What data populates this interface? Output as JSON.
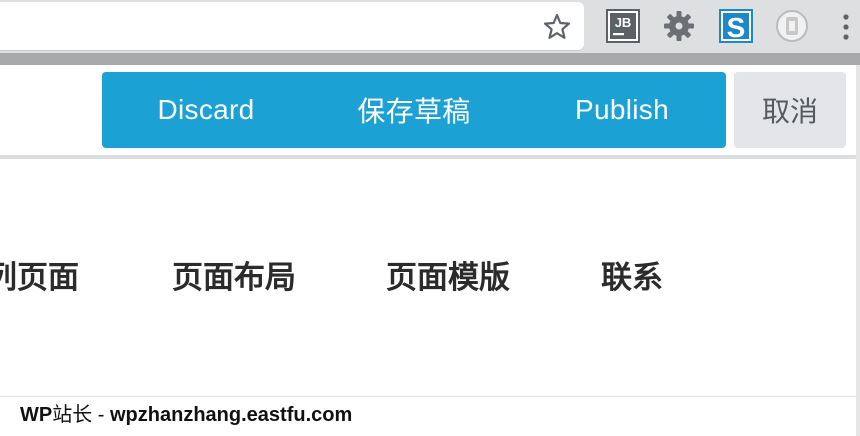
{
  "toolbar": {
    "discard_label": "Discard",
    "save_draft_label": "保存草稿",
    "publish_label": "Publish",
    "cancel_label": "取消",
    "accent_color": "#1ca1d4"
  },
  "extensions": {
    "jb_label": "JB",
    "s_label": "S"
  },
  "nav": {
    "items": [
      {
        "label": "列页面"
      },
      {
        "label": "页面布局"
      },
      {
        "label": "页面模版"
      },
      {
        "label": "联系"
      }
    ]
  },
  "footer": {
    "brand": "WP",
    "brand_suffix": "站长",
    "separator": " - ",
    "site": "wpzhanzhang.eastfu.com"
  }
}
